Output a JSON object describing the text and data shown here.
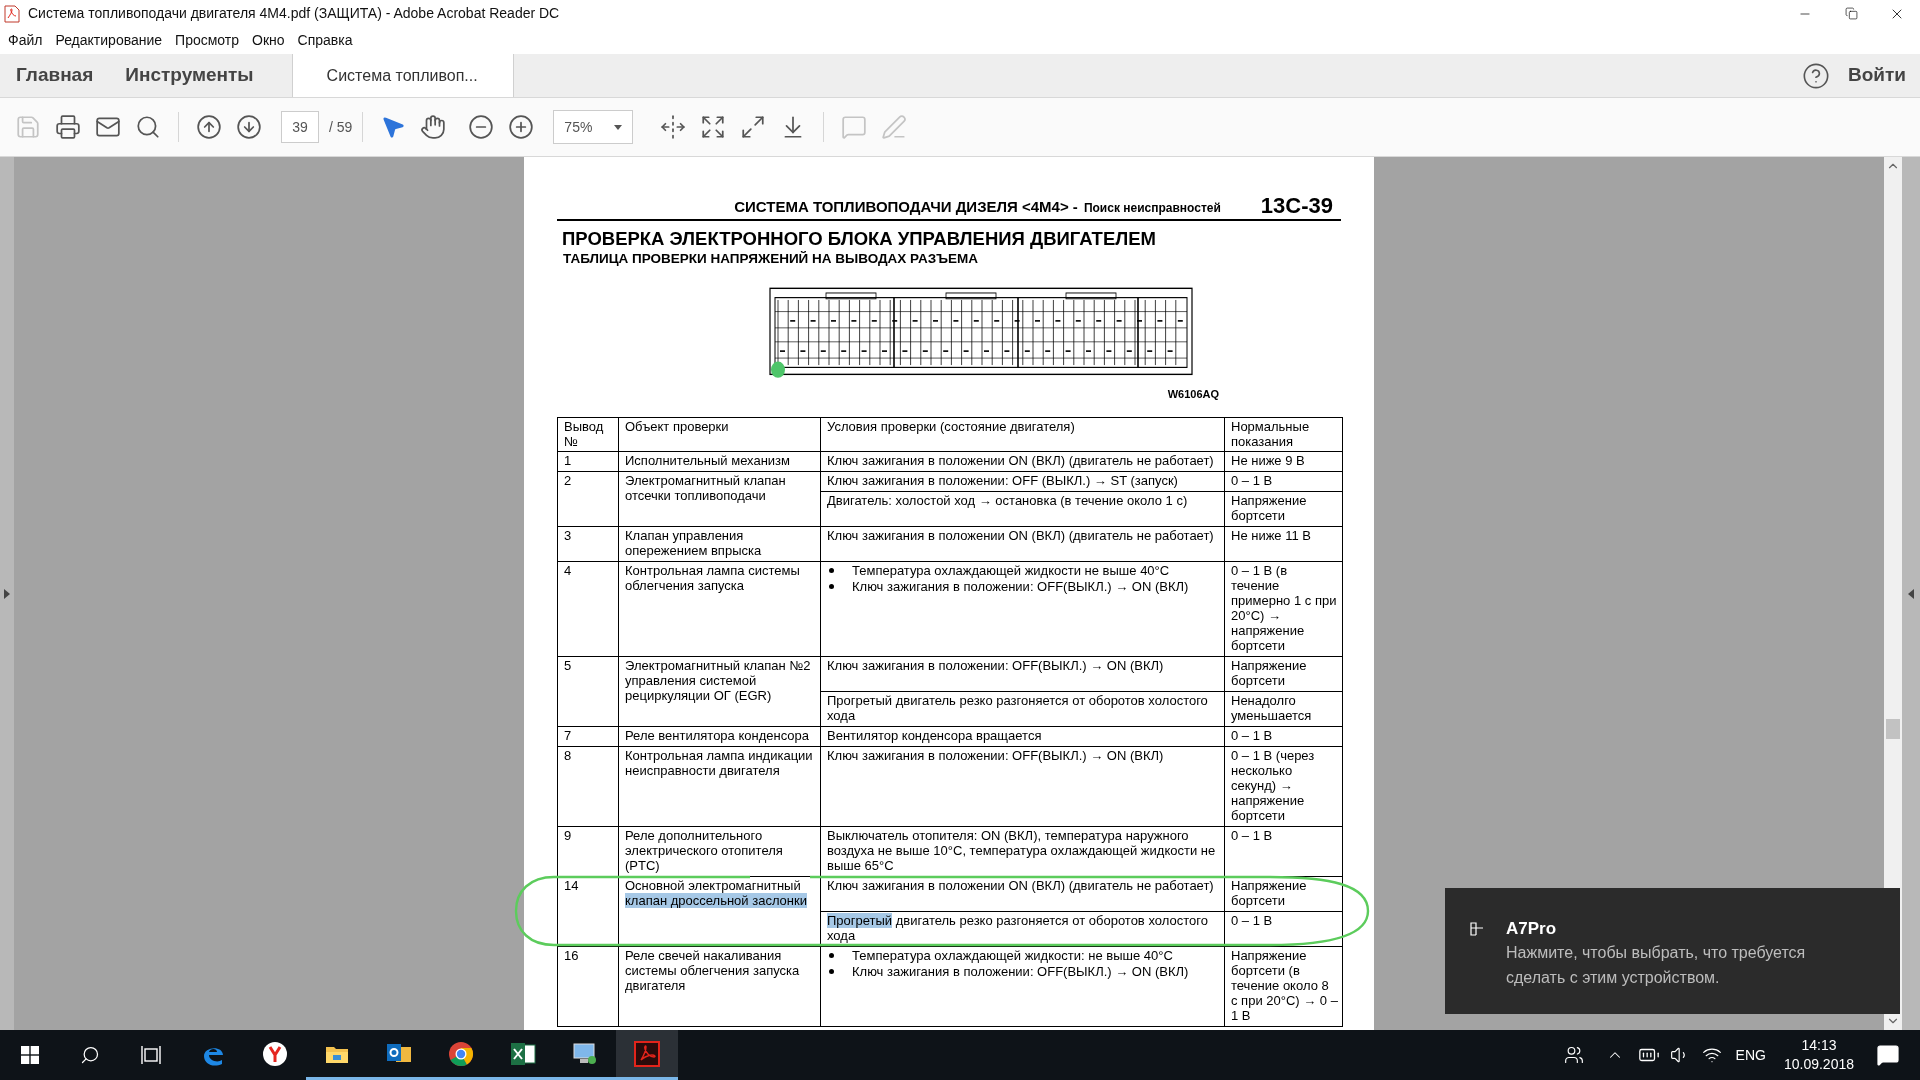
{
  "window": {
    "title": "Система топливоподачи двигателя 4M4.pdf (ЗАЩИТА) - Adobe Acrobat Reader DC"
  },
  "menu": [
    "Файл",
    "Редактирование",
    "Просмотр",
    "Окно",
    "Справка"
  ],
  "tabs": [
    {
      "kind": "nav",
      "label": "Главная",
      "selected": false
    },
    {
      "kind": "nav",
      "label": "Инструменты",
      "selected": false
    },
    {
      "kind": "document",
      "label": "Система топливоп...",
      "selected": true
    }
  ],
  "account": {
    "label": "Войти"
  },
  "toolbar": {
    "file_tools": [
      {
        "kind": "save",
        "disabled": true
      },
      {
        "kind": "print",
        "disabled": false
      },
      {
        "kind": "email",
        "disabled": false
      },
      {
        "kind": "search",
        "disabled": false
      }
    ],
    "nav_tools": [
      {
        "kind": "prev",
        "disabled": false
      },
      {
        "kind": "next",
        "disabled": false
      }
    ],
    "page_field": {
      "value": "39"
    },
    "page_total": "/ 59",
    "pointer_tools": [
      {
        "kind": "select",
        "selected": true
      },
      {
        "kind": "hand",
        "selected": false
      }
    ],
    "zoom_tools": [
      {
        "kind": "zoom-out",
        "disabled": false
      },
      {
        "kind": "zoom-in",
        "disabled": false
      }
    ],
    "zoom_field": {
      "value": "75%"
    },
    "view_tools": [
      {
        "kind": "fit-width",
        "disabled": false
      },
      {
        "kind": "fit-page",
        "disabled": false
      },
      {
        "kind": "full-screen",
        "disabled": false
      },
      {
        "kind": "read-mode",
        "disabled": false
      }
    ],
    "comment_tools": [
      {
        "kind": "comment",
        "disabled": true
      },
      {
        "kind": "sign",
        "disabled": true
      }
    ]
  },
  "page": {
    "header": "СИСТЕМА ТОПЛИВОПОДАЧИ ДИЗЕЛЯ <4M4> -",
    "header_section": "Поиск неисправностей",
    "page_number": "13C-39",
    "title": "ПРОВЕРКА ЭЛЕКТРОННОГО БЛОКА УПРАВЛЕНИЯ ДВИГАТЕЛЕМ",
    "subtitle": "ТАБЛИЦА ПРОВЕРКИ НАПРЯЖЕНИЙ НА ВЫВОДАХ РАЗЪЕМА",
    "figure_code": "W6106AQ",
    "table": {
      "columns": [
        "Вывод №",
        "Объект проверки",
        "Условия проверки (состояние двигателя)",
        "Нормальные показания"
      ],
      "rows": [
        {
          "pin": "1",
          "object": "Исполнительный механизм",
          "checks": [
            {
              "kind": "text",
              "condition": "Ключ зажигания в положении ON (ВКЛ) (двигатель не работает)",
              "normal": "Не ниже 9 В"
            }
          ]
        },
        {
          "pin": "2",
          "object": "Электромагнитный клапан отсечки топливоподачи",
          "checks": [
            {
              "kind": "text",
              "condition": "Ключ зажигания в положении: OFF (ВЫКЛ.) → ST (запуск)",
              "normal": "0 – 1 В"
            },
            {
              "kind": "text",
              "condition": "Двигатель: холостой ход → остановка (в течение около 1 с)",
              "normal": "Напряжение бортсети"
            }
          ]
        },
        {
          "pin": "3",
          "object": "Клапан управления опережением впрыска",
          "checks": [
            {
              "kind": "text",
              "condition": "Ключ зажигания в положении ON (ВКЛ) (двигатель не работает)",
              "normal": "Не ниже 11 В"
            }
          ]
        },
        {
          "pin": "4",
          "object": "Контрольная лампа системы облегчения запуска",
          "checks": [
            {
              "kind": "bullets",
              "condition": [
                "Температура охлаждающей жидкости не выше 40°C",
                "Ключ зажигания в положении: OFF(ВЫКЛ.) → ON (ВКЛ)"
              ],
              "normal": "0 – 1 В (в течение примерно 1 с при 20°C) → напряжение бортсети"
            }
          ]
        },
        {
          "pin": "5",
          "object": "Электромагнитный клапан №2 управления системой рециркуляции ОГ (EGR)",
          "checks": [
            {
              "kind": "text",
              "condition": "Ключ зажигания в положении: OFF(ВЫКЛ.) → ON (ВКЛ)",
              "normal": "Напряжение бортсети"
            },
            {
              "kind": "text",
              "condition": "Прогретый двигатель резко разгоняется от оборотов холостого хода",
              "normal": "Ненадолго уменьшается"
            }
          ]
        },
        {
          "pin": "7",
          "object": "Реле вентилятора конденсора",
          "checks": [
            {
              "kind": "text",
              "condition": "Вентилятор конденсора вращается",
              "normal": "0 – 1 В"
            }
          ]
        },
        {
          "pin": "8",
          "object": "Контрольная лампа индикации неисправности двигателя",
          "checks": [
            {
              "kind": "text",
              "condition": "Ключ зажигания в положении: OFF(ВЫКЛ.) → ON (ВКЛ)",
              "normal": "0 – 1 В (через несколько секунд) → напряжение бортсети"
            }
          ]
        },
        {
          "pin": "9",
          "object": "Реле дополнительного электрического отопителя (PTC)",
          "checks": [
            {
              "kind": "text",
              "condition": "Выключатель отопителя: ON (ВКЛ), температура наружного воздуха не выше 10°C, температура охлаждающей жидкости не выше 65°C",
              "normal": "0 – 1 В"
            }
          ]
        },
        {
          "pin": "14",
          "object": [
            {
              "text": "Основной электромагнитный ",
              "highlighted": false
            },
            {
              "text": "клапан дроссельной заслонки",
              "highlighted": true
            }
          ],
          "checks": [
            {
              "kind": "text",
              "condition": "Ключ зажигания в положении ON (ВКЛ) (двигатель не работает)",
              "normal": "Напряжение бортсети"
            },
            {
              "kind": "text",
              "condition": [
                {
                  "text": "Прогретый",
                  "highlighted": true
                },
                {
                  "text": " двигатель резко разгоняется от оборотов холостого хода",
                  "highlighted": false
                }
              ],
              "normal": "0 – 1 В"
            }
          ]
        },
        {
          "pin": "16",
          "object": "Реле свечей накаливания системы облегчения запуска двигателя",
          "checks": [
            {
              "kind": "bullets",
              "condition": [
                "Температура охлаждающей жидкости: не выше 40°C",
                "Ключ зажигания в положении: OFF(ВЫКЛ.) → ON (ВКЛ)"
              ],
              "normal": "Напряжение бортсети (в течение около 8 с при 20°C) → 0 – 1 В"
            }
          ]
        }
      ]
    }
  },
  "notification": {
    "title": "A7Pro",
    "message": "Нажмите, чтобы выбрать, что требуется сделать с этим устройством."
  },
  "taskbar": {
    "apps": [
      {
        "kind": "edge",
        "running": false,
        "selected": false
      },
      {
        "kind": "yandex",
        "running": false,
        "selected": false
      },
      {
        "kind": "explorer",
        "running": true,
        "selected": false
      },
      {
        "kind": "outlook",
        "running": true,
        "selected": false
      },
      {
        "kind": "chrome",
        "running": true,
        "selected": false
      },
      {
        "kind": "excel",
        "running": true,
        "selected": false
      },
      {
        "kind": "remote",
        "running": true,
        "selected": false
      },
      {
        "kind": "acrobat",
        "running": true,
        "selected": true
      }
    ],
    "language": "ENG",
    "time": "14:13",
    "date": "10.09.2018"
  }
}
